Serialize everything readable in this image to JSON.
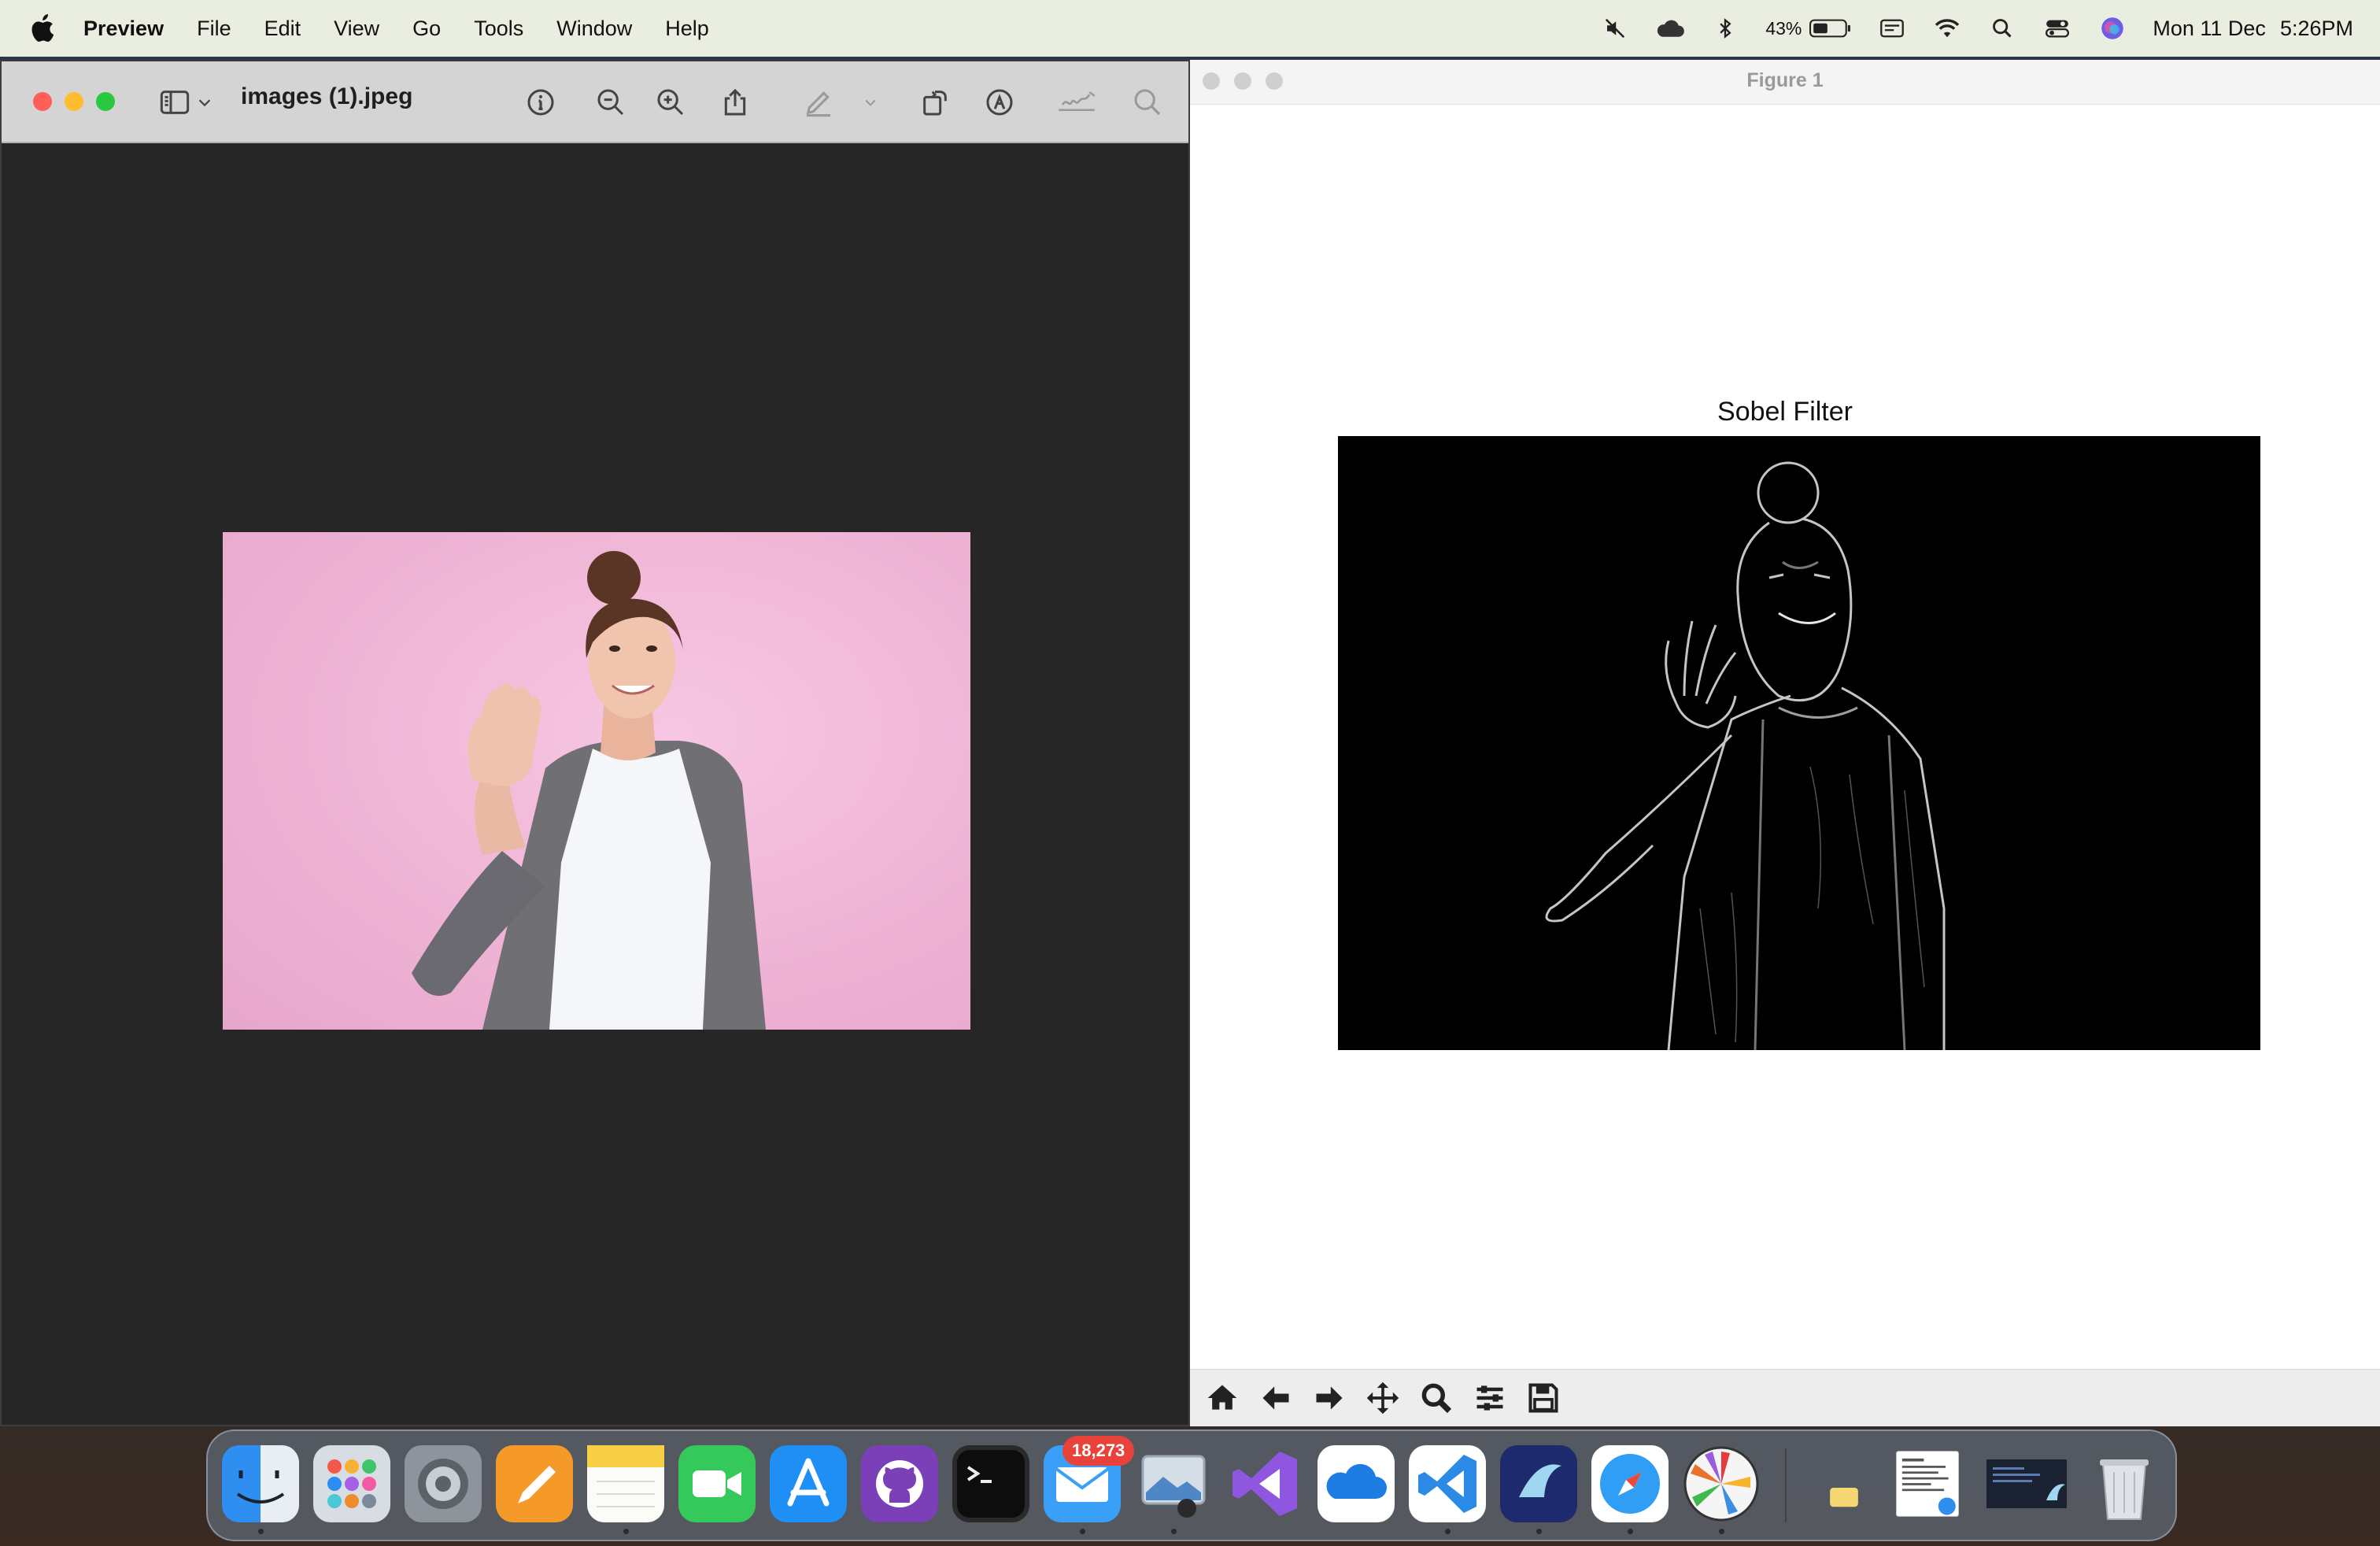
{
  "menubar": {
    "app_name": "Preview",
    "menus": [
      "File",
      "Edit",
      "View",
      "Go",
      "Tools",
      "Window",
      "Help"
    ],
    "battery_percent": "43%",
    "date": "Mon 11 Dec",
    "time": "5:26PM",
    "status_icons": [
      "mute-icon",
      "cloud-icon",
      "bluetooth-icon",
      "battery-icon",
      "keyboard-input-icon",
      "wifi-icon",
      "spotlight-icon",
      "control-center-icon",
      "siri-icon"
    ]
  },
  "preview": {
    "filename": "images (1).jpeg",
    "toolbar_icons": [
      "sidebar-toggle-icon",
      "chevron-down-icon",
      "info-icon",
      "zoom-out-icon",
      "zoom-in-icon",
      "share-icon",
      "markup-pen-icon",
      "chevron-down-icon",
      "rotate-icon",
      "markup-icon",
      "signature-icon",
      "search-icon"
    ],
    "image_subject": "photo"
  },
  "figure": {
    "window_title": "Figure 1",
    "plot_title": "Sobel Filter",
    "toolbar_icons": [
      "home-icon",
      "back-arrow-icon",
      "forward-arrow-icon",
      "pan-icon",
      "zoom-icon",
      "configure-subplots-icon",
      "save-icon"
    ]
  },
  "dock": {
    "apps": [
      "Finder",
      "Launchpad",
      "System Settings",
      "Pages",
      "Notes",
      "FaceTime",
      "App Store",
      "GitHub Desktop",
      "Terminal",
      "Mail",
      "Preview",
      "Visual Studio",
      "OneDrive",
      "Visual Studio Code",
      "Microsoft Remote Desktop",
      "Safari",
      "Python"
    ],
    "mail_badge": "18,273",
    "right_items": [
      "Downloads stack",
      "Documents stack",
      "Recent window",
      "Trash"
    ]
  }
}
